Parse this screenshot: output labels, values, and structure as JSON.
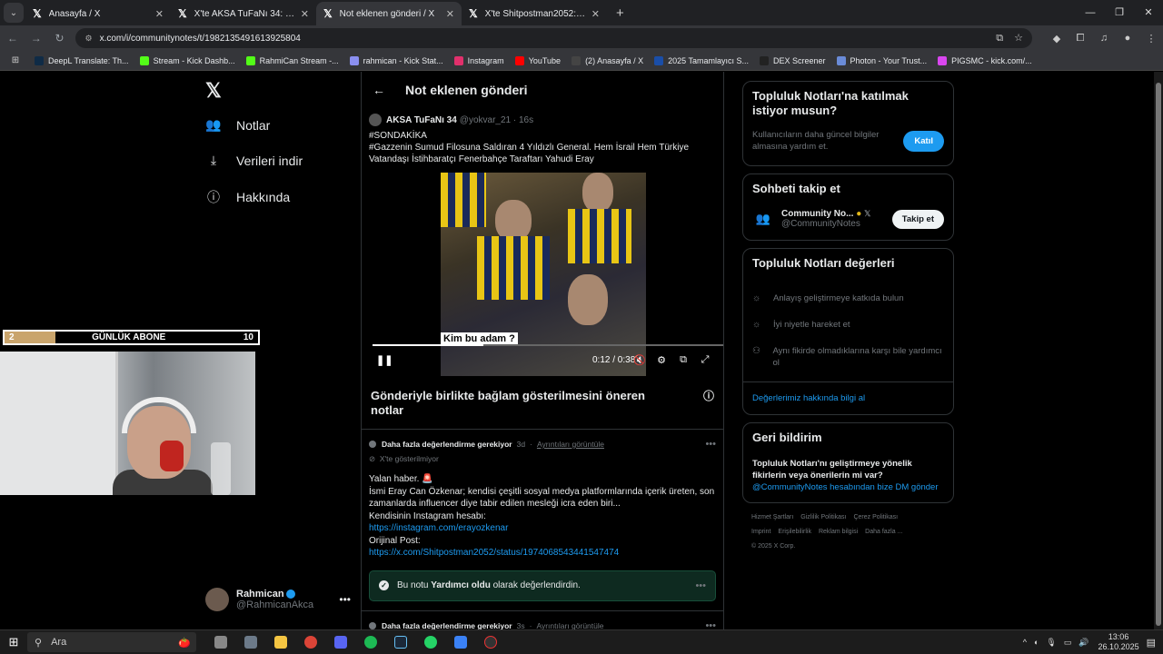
{
  "browser": {
    "tabs": [
      {
        "title": "Anasayfa / X",
        "active": false
      },
      {
        "title": "X'te AKSA TuFaNı 34: \"#SONDA",
        "active": false
      },
      {
        "title": "Not eklenen gönderi / X",
        "active": true
      },
      {
        "title": "X'te Shitpostman2052: \"Olay ın",
        "active": false
      }
    ],
    "url": "x.com/i/communitynotes/t/1982135491613925804",
    "bookmarks": [
      {
        "label": "DeepL Translate: Th...",
        "color": "#0f2b46"
      },
      {
        "label": "Stream - Kick Dashb...",
        "color": "#53fc18"
      },
      {
        "label": "RahmiCan Stream -...",
        "color": "#53fc18"
      },
      {
        "label": "rahmican - Kick Stat...",
        "color": "#8a8ff0"
      },
      {
        "label": "Instagram",
        "color": "#e1306c"
      },
      {
        "label": "YouTube",
        "color": "#ff0000"
      },
      {
        "label": "(2) Anasayfa / X",
        "color": "#444444"
      },
      {
        "label": "2025 Tamamlayıcı S...",
        "color": "#1a4ea8"
      },
      {
        "label": "DEX Screener",
        "color": "#222222"
      },
      {
        "label": "Photon - Your Trust...",
        "color": "#6a8bd8"
      },
      {
        "label": "PIGSMC - kick.com/...",
        "color": "#d946ef"
      }
    ]
  },
  "left_nav": {
    "items": [
      {
        "icon": "people-icon",
        "glyph": "👥",
        "label": "Notlar"
      },
      {
        "icon": "download-icon",
        "glyph": "⤓",
        "label": "Verileri indir"
      },
      {
        "icon": "info-icon",
        "glyph": "ⓘ",
        "label": "Hakkında"
      }
    ],
    "user": {
      "name": "Rahmican",
      "handle": "@RahmicanAkca"
    }
  },
  "main": {
    "title": "Not eklenen gönderi",
    "post": {
      "author": "AKSA TuFaNı 34",
      "handle": "@yokvar_21",
      "time": "16s",
      "text": "#SONDAKİKA\n#Gazzenin Sumud Filosuna Saldıran 4 Yıldızlı General. Hem İsrail Hem Türkiye Vatandaşı İstihbaratçı Fenerbahçe Taraftarı Yahudi Eray"
    },
    "video": {
      "caption": "Kim bu adam ?",
      "time": "0:12 / 0:38",
      "progress": 0.316
    },
    "notes_section_title": "Gönderiyle birlikte bağlam gösterilmesini öneren notlar",
    "notes": [
      {
        "status": "Daha fazla değerlendirme gerekiyor",
        "time": "3d",
        "details_link": "Ayrıntıları görüntüle",
        "sub": "X'te gösterilmiyor",
        "body": "Yalan haber. 🚨\nİsmi Eray Can Özkenar; kendisi çeşitli sosyal medya platformlarında içerik üreten, son zamanlarda influencer diye tabir edilen mesleği icra eden biri...\nKendisinin Instagram hesabı:",
        "link1": "https://instagram.com/erayozkenar",
        "label2": "Orijinal Post:",
        "link2": "https://x.com/Shitpostman2052/status/1974068543441547474",
        "rated_prefix": "Bu notu",
        "rated_bold": "Yardımcı oldu",
        "rated_suffix": "olarak değerlendirdin."
      },
      {
        "status": "Daha fazla değerlendirme gerekiyor",
        "time": "3s",
        "details_link": "Ayrıntıları görüntüle"
      }
    ]
  },
  "right": {
    "join": {
      "title": "Topluluk Notları'na katılmak istiyor musun?",
      "text": "Kullanıcıların daha güncel bilgiler almasına yardım et.",
      "button": "Katıl"
    },
    "follow": {
      "title": "Sohbeti takip et",
      "name": "Community No...",
      "handle": "@CommunityNotes",
      "button": "Takip et"
    },
    "values": {
      "title": "Topluluk Notları değerleri",
      "items": [
        "Anlayış geliştirmeye katkıda bulun",
        "İyi niyetle hareket et",
        "Aynı fikirde olmadıklarına karşı bile yardımcı ol"
      ],
      "link": "Değerlerimiz hakkında bilgi al"
    },
    "feedback": {
      "title": "Geri bildirim",
      "text": "Topluluk Notları'nı geliştirmeye yönelik fikirlerin veya önerilerin mi var?",
      "link": "@CommunityNotes hesabından bize DM gönder"
    },
    "footer": [
      "Hizmet Şartları",
      "Gizlilik Politikası",
      "Çerez Politikası",
      "Imprint",
      "Erişilebilirlik",
      "Reklam bilgisi",
      "Daha fazla ...",
      "© 2025 X Corp."
    ]
  },
  "overlay": {
    "abone_left": "2",
    "abone_label": "GÜNLÜK ABONE",
    "abone_right": "10",
    "abone_progress": 0.2
  },
  "taskbar": {
    "search": "Ara",
    "time": "13:06",
    "date": "26.10.2025"
  }
}
